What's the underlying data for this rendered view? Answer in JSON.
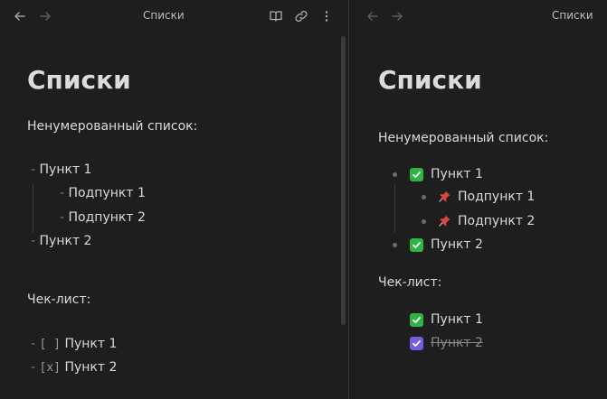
{
  "left_pane": {
    "title": "Списки",
    "heading": "Списки",
    "unordered_label": "Ненумерованный список:",
    "list": [
      {
        "marker": "-",
        "text": "Пункт 1"
      },
      {
        "marker": "-",
        "text": "Подпункт 1"
      },
      {
        "marker": "-",
        "text": "Подпункт 2"
      },
      {
        "marker": "-",
        "text": "Пункт 2"
      }
    ],
    "checklist_label": "Чек-лист:",
    "checklist": [
      {
        "marker": "-",
        "box": "[ ]",
        "text": "Пункт 1"
      },
      {
        "marker": "-",
        "box": "[x]",
        "text": "Пункт 2"
      }
    ]
  },
  "right_pane": {
    "title": "Списки",
    "heading": "Списки",
    "unordered_label": "Ненумерованный список:",
    "list": [
      {
        "icon": "check-mark-button-icon",
        "text": "Пункт 1"
      },
      {
        "icon": "pushpin-icon",
        "text": "Подпункт 1"
      },
      {
        "icon": "pushpin-icon",
        "text": "Подпункт 2"
      },
      {
        "icon": "check-mark-button-icon",
        "text": "Пункт 2"
      }
    ],
    "checklist_label": "Чек-лист:",
    "checklist": [
      {
        "checked": false,
        "icon": "check-mark-button-icon",
        "text": "Пункт 1"
      },
      {
        "checked": true,
        "icon": "checkbox-checked-icon",
        "text": "Пункт 2"
      }
    ]
  },
  "colors": {
    "background": "#1e1e1e",
    "text": "#dadada",
    "green_check": "#2fb344",
    "purple_check": "#7b5be0",
    "pin_red": "#e0443a"
  }
}
